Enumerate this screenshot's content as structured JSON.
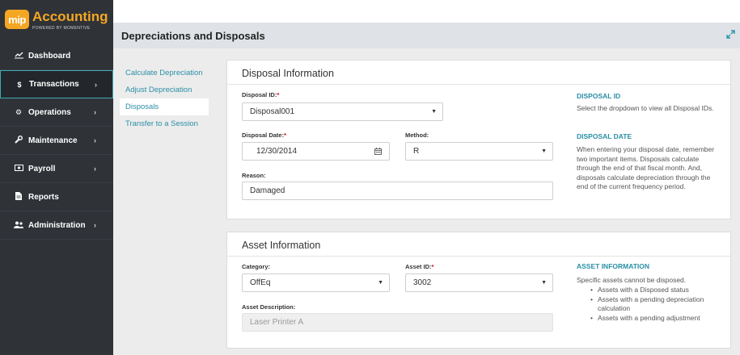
{
  "app": {
    "logo_badge": "mip",
    "logo_title": "Accounting",
    "logo_sub": "POWERED BY MOMENTIVE"
  },
  "sidebar": {
    "items": [
      {
        "label": "Dashboard",
        "icon": "chart-line-icon"
      },
      {
        "label": "Transactions",
        "icon": "dollar-icon"
      },
      {
        "label": "Operations",
        "icon": "cogs-icon"
      },
      {
        "label": "Maintenance",
        "icon": "wrench-icon"
      },
      {
        "label": "Payroll",
        "icon": "money-icon"
      },
      {
        "label": "Reports",
        "icon": "file-icon"
      },
      {
        "label": "Administration",
        "icon": "users-icon"
      }
    ],
    "active": "Transactions"
  },
  "header": {
    "title": "Depreciations and Disposals"
  },
  "subnav": {
    "items": [
      "Calculate Depreciation",
      "Adjust Depreciation",
      "Disposals",
      "Transfer to a Session"
    ],
    "selected": "Disposals"
  },
  "disposal": {
    "title": "Disposal Information",
    "id_label": "Disposal ID:",
    "id_value": "Disposal001",
    "date_label": "Disposal Date:",
    "date_value": "12/30/2014",
    "method_label": "Method:",
    "method_value": "R",
    "reason_label": "Reason:",
    "reason_value": "Damaged",
    "required_mark": "*",
    "help": {
      "h1": "DISPOSAL ID",
      "p1": "Select the dropdown to view all Disposal IDs.",
      "h2": "DISPOSAL DATE",
      "p2": "When entering your disposal date, remember two important items. Disposals calculate through the end of that fiscal month. And, disposals calculate depreciation through the end of the current frequency period."
    }
  },
  "asset": {
    "title": "Asset Information",
    "category_label": "Category:",
    "category_value": "OffEq",
    "asset_id_label": "Asset ID:",
    "asset_id_value": "3002",
    "desc_label": "Asset Description:",
    "desc_value": "Laser Printer A",
    "required_mark": "*",
    "help": {
      "h1": "ASSET INFORMATION",
      "p1": "Specific assets cannot be disposed.",
      "bullets": [
        "Assets with a Disposed status",
        "Assets with a pending depreciation calculation",
        "Assets with a pending adjustment"
      ]
    }
  },
  "colors": {
    "sidebar_bg": "#2f3338",
    "accent": "#2a8fa6",
    "logo_orange": "#f5a623"
  }
}
